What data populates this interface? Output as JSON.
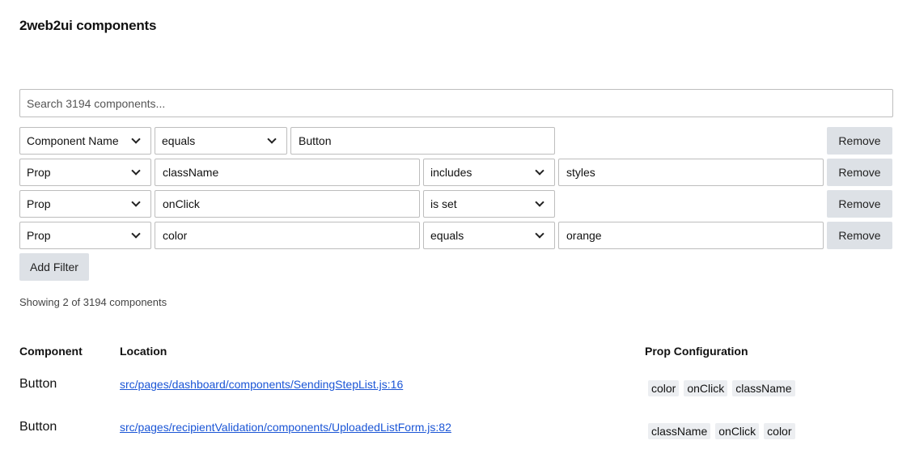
{
  "title": "2web2ui components",
  "search": {
    "placeholder": "Search 3194 components..."
  },
  "filters": [
    {
      "field": "Component Name",
      "operator": "equals",
      "value": "Button"
    },
    {
      "field": "Prop",
      "prop_name": "className",
      "operator": "includes",
      "value": "styles"
    },
    {
      "field": "Prop",
      "prop_name": "onClick",
      "operator": "is set"
    },
    {
      "field": "Prop",
      "prop_name": "color",
      "operator": "equals",
      "value": "orange"
    }
  ],
  "remove_label": "Remove",
  "add_filter_label": "Add Filter",
  "status": "Showing 2 of 3194 components",
  "table": {
    "headers": [
      "Component",
      "Location",
      "Prop Configuration"
    ],
    "rows": [
      {
        "component": "Button",
        "location": "src/pages/dashboard/components/SendingStepList.js:16",
        "props": [
          "color",
          "onClick",
          "className"
        ]
      },
      {
        "component": "Button",
        "location": "src/pages/recipientValidation/components/UploadedListForm.js:82",
        "props": [
          "className",
          "onClick",
          "color"
        ]
      }
    ]
  },
  "colors": {
    "link": "#1a55d6",
    "button_bg": "#dde1e6",
    "chip_bg": "#eceef1"
  }
}
